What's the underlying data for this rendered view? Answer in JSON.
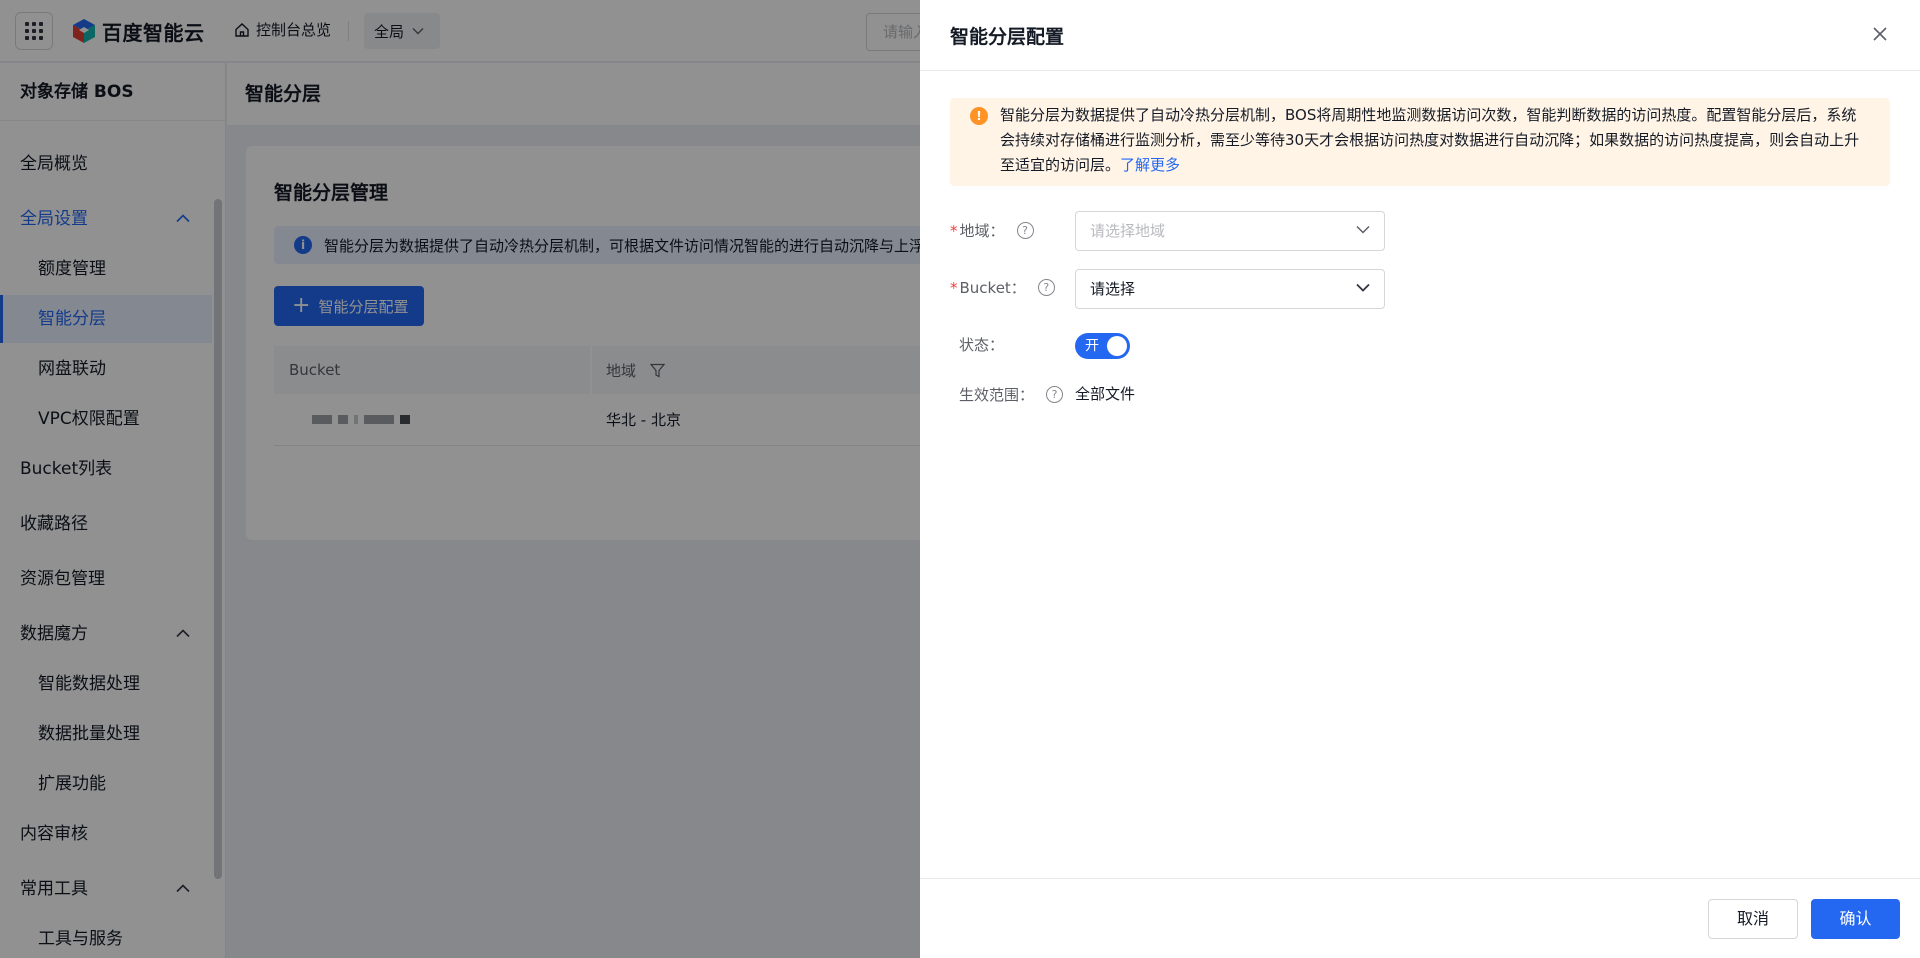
{
  "colors": {
    "accent": "#2468f2",
    "warning": "#ff9326",
    "alert_bg": "#fff4e6",
    "info_bg": "#e6f0ff"
  },
  "topbar": {
    "brand": "百度智能云",
    "home_link": "控制台总览",
    "region": "全局",
    "search_placeholder": "请输入"
  },
  "sidebar": {
    "title": "对象存储 BOS",
    "items": [
      {
        "label": "全局概览"
      },
      {
        "label": "全局设置",
        "expanded": true
      },
      {
        "label": "额度管理"
      },
      {
        "label": "智能分层",
        "active": true
      },
      {
        "label": "网盘联动"
      },
      {
        "label": "VPC权限配置"
      },
      {
        "label": "Bucket列表"
      },
      {
        "label": "收藏路径"
      },
      {
        "label": "资源包管理"
      },
      {
        "label": "数据魔方",
        "expanded": true
      },
      {
        "label": "智能数据处理"
      },
      {
        "label": "数据批量处理"
      },
      {
        "label": "扩展功能"
      },
      {
        "label": "内容审核"
      },
      {
        "label": "常用工具",
        "expanded": true
      },
      {
        "label": "工具与服务"
      }
    ]
  },
  "page": {
    "header": "智能分层",
    "card_title": "智能分层管理",
    "info": "智能分层为数据提供了自动冷热分层机制，可根据文件访问情况智能的进行自动沉降与上浮",
    "add_button": "智能分层配置",
    "table": {
      "columns": [
        "Bucket",
        "地域"
      ],
      "rows": [
        {
          "bucket": "",
          "region": "华北 - 北京"
        }
      ]
    }
  },
  "drawer": {
    "title": "智能分层配置",
    "alert_text": "智能分层为数据提供了自动冷热分层机制，BOS将周期性地监测数据访问次数，智能判断数据的访问热度。配置智能分层后，系统会持续对存储桶进行监测分析，需至少等待30天才会根据访问热度对数据进行自动沉降；如果数据的访问热度提高，则会自动上升至适宜的访问层。",
    "alert_link": "了解更多",
    "fields": {
      "region_label": "地域：",
      "region_placeholder": "请选择地域",
      "bucket_label": "Bucket：",
      "bucket_value": "请选择",
      "status_label": "状态：",
      "status_toggle": "开",
      "status_on": true,
      "scope_label": "生效范围：",
      "scope_value": "全部文件"
    },
    "help_glyph": "?",
    "cancel": "取消",
    "confirm": "确认"
  }
}
